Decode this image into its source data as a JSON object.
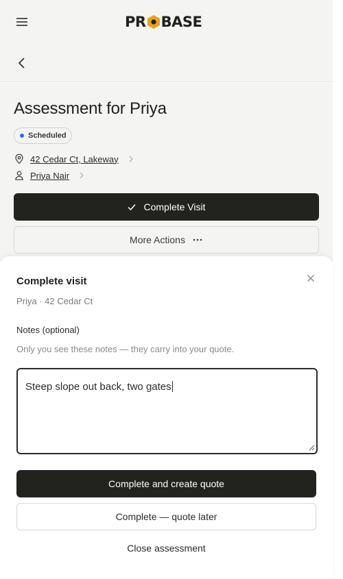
{
  "header": {
    "logo_text_left": "PR",
    "logo_text_right": "BASE"
  },
  "page": {
    "title": "Assessment for Priya",
    "status_badge": "Scheduled",
    "address_link": "42 Cedar Ct, Lakeway",
    "client_link": "Priya Nair",
    "complete_visit_label": "Complete Visit",
    "more_actions_label": "More Actions"
  },
  "sheet": {
    "title": "Complete visit",
    "subtitle": "Priya · 42 Cedar Ct",
    "notes_label": "Notes (optional)",
    "notes_hint": "Only you see these notes — they carry into your quote.",
    "notes_value": "Steep slope out back, two gates",
    "complete_create_quote_label": "Complete and create quote",
    "complete_quote_later_label": "Complete — quote later",
    "close_assessment_label": "Close assessment"
  },
  "colors": {
    "accent_dark": "#22221f",
    "badge_dot": "#2f6fe0",
    "logo_hex": "#e8a317",
    "background": "#f4f4f2"
  },
  "icons": {
    "menu": "hamburger-menu-icon",
    "back": "chevron-left-icon",
    "location": "map-pin-icon",
    "client": "person-icon",
    "chevron": "chevron-right-icon",
    "check": "check-icon",
    "more": "ellipsis-icon",
    "close": "close-icon"
  }
}
